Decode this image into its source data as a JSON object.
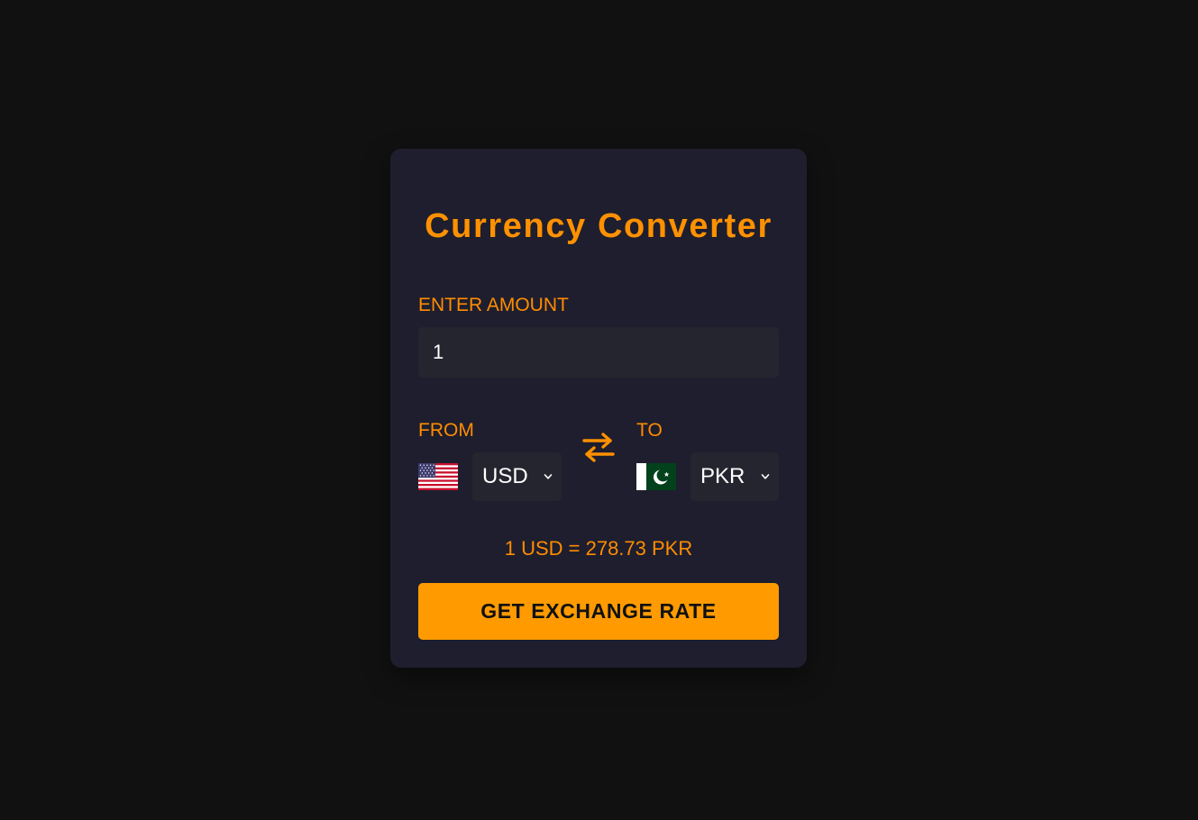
{
  "app": {
    "title": "Currency Converter"
  },
  "amount": {
    "label": "ENTER AMOUNT",
    "value": "1"
  },
  "from": {
    "label": "FROM",
    "currency": "USD",
    "flag": "us-flag-icon"
  },
  "to": {
    "label": "TO",
    "currency": "PKR",
    "flag": "pk-flag-icon"
  },
  "swap": {
    "icon": "swap-arrows-icon"
  },
  "result": {
    "text": "1 USD = 278.73 PKR"
  },
  "action": {
    "button_label": "GET EXCHANGE RATE"
  },
  "colors": {
    "page_background": "#111111",
    "card_background": "#1e1e2e",
    "accent": "#ff9100",
    "button": "#ff9b00",
    "input_background": "#25252f"
  }
}
